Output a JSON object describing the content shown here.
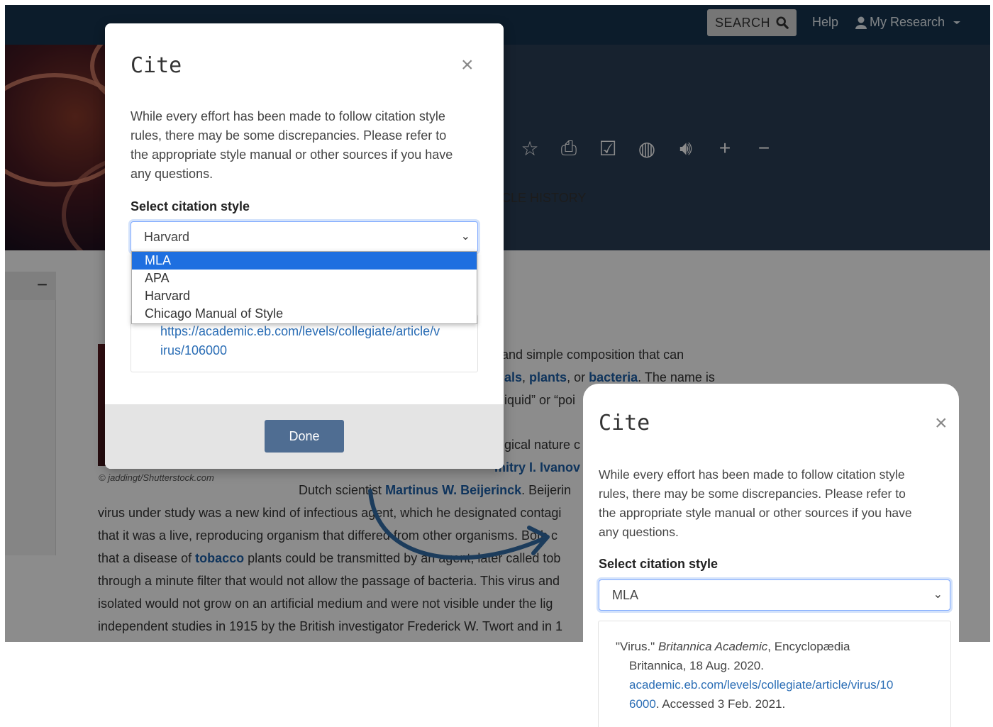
{
  "topbar": {
    "search_label": "SEARCH",
    "help_label": "Help",
    "my_research_label": "My Research"
  },
  "article": {
    "tab_history": "CLE HISTORY",
    "image_credit": "© jaddingt/Shutterstock.com",
    "lines": [
      "and simple composition that can",
      "The name is",
      "iquid” or “poi",
      "gical nature c",
      "Dutch scientist",
      "Beijerin",
      "virus under study was a new kind of infectious agent, which he designated contagi",
      "that it was a live, reproducing organism that differed from other organisms. Both c",
      "that a disease of",
      "plants could be transmitted by an agent, later called tob",
      "through a minute filter that would not allow the passage of bacteria. This virus and",
      "isolated would not grow on an artificial medium and were not visible under the lig",
      "independent studies in 1915 by the British investigator Frederick W. Twort and in 1"
    ],
    "links": {
      "animals": "als",
      "plants": "plants",
      "or": ", or",
      "bacteria": "bacteria",
      "ivanov": "mitry I. Ivanov",
      "beijerinck": "Martinus W. Beijerinck",
      "tobacco": "tobacco"
    }
  },
  "modal1": {
    "title": "Cite",
    "close": "×",
    "notice": [
      "While every effort has been made to follow citation style",
      "rules, there may be some discrepancies. Please refer to",
      "the appropriate style manual or other sources if you have",
      "any questions."
    ],
    "select_label": "Select citation style",
    "selected_value": "Harvard",
    "options": [
      "MLA",
      "APA",
      "Harvard",
      "Chicago Manual of Style"
    ],
    "highlighted_option": "MLA",
    "citation_url": [
      "https://academic.eb.com/levels/collegiate/article/v",
      "irus/106000"
    ],
    "done_label": "Done"
  },
  "modal2": {
    "title": "Cite",
    "close": "×",
    "notice": [
      "While every effort has been made to follow citation style",
      "rules, there may be some discrepancies. Please refer to",
      "the appropriate style manual or other sources if you have",
      "any questions."
    ],
    "select_label": "Select citation style",
    "selected_value": "MLA",
    "citation": {
      "title_quote": "\"Virus.\"",
      "source": "Britannica Academic",
      "publisher_line1": ", Encyclopædia",
      "publisher_line2": "Britannica, 18 Aug. 2020.",
      "url_line1": "academic.eb.com/levels/collegiate/article/virus/10",
      "url_line2": "6000",
      "accessed": ". Accessed 3 Feb. 2021."
    }
  },
  "colors": {
    "topbar": "#16344f",
    "hero": "#2b3e56",
    "link": "#1d5fa8",
    "highlight": "#1e6fe0",
    "done_button": "#4f6d92",
    "arrow": "#1c3c5c"
  },
  "icons": [
    "search-icon",
    "user-icon",
    "caret-down-icon",
    "star-icon",
    "print-icon",
    "checkbox-icon",
    "globe-icon",
    "speaker-icon",
    "plus-icon",
    "minus-icon",
    "close-icon",
    "chevron-down-icon",
    "arrow-icon"
  ]
}
